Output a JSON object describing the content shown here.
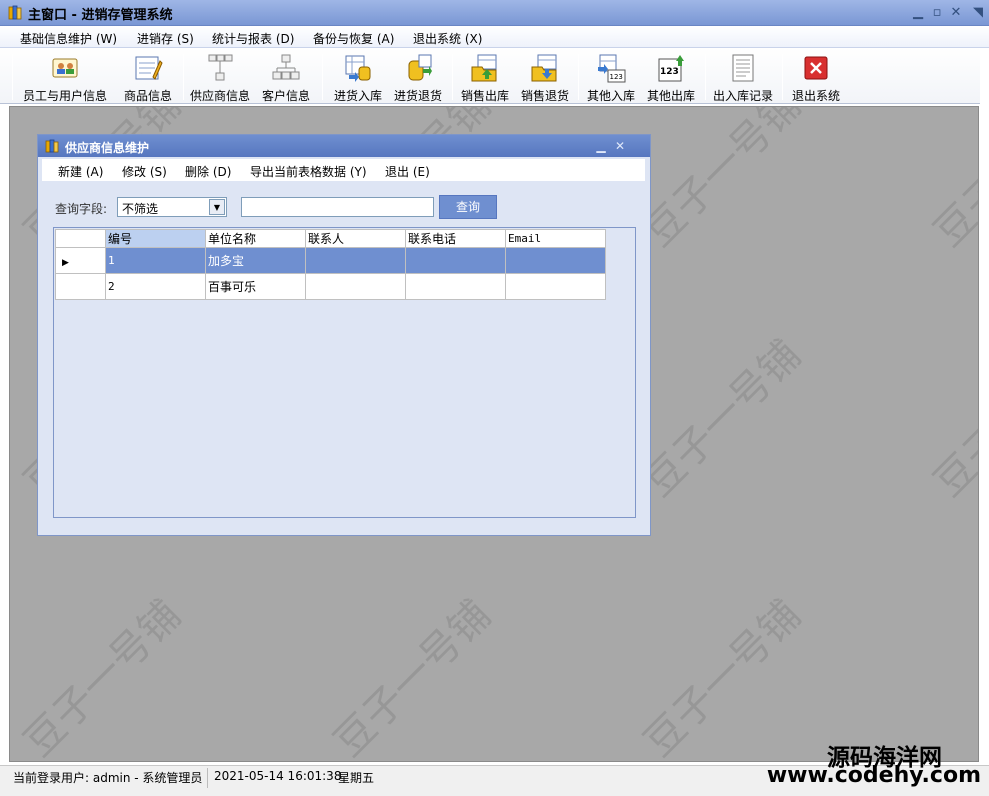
{
  "window": {
    "title": "主窗口 - 进销存管理系统",
    "icon": "books-icon",
    "controls": [
      "minimize",
      "maximize",
      "close"
    ]
  },
  "menubar": [
    "基础信息维护 (W)",
    "进销存 (S)",
    "统计与报表 (D)",
    "备份与恢复 (A)",
    "退出系统 (X)"
  ],
  "toolbar": [
    {
      "label": "员工与用户信息",
      "icon": "staff-icon"
    },
    {
      "label": "商品信息",
      "icon": "product-edit-icon"
    },
    {
      "label": "供应商信息",
      "icon": "supplier-tree-icon"
    },
    {
      "label": "客户信息",
      "icon": "customer-tree-icon"
    },
    {
      "label": "进货入库",
      "icon": "stock-in-icon"
    },
    {
      "label": "进货退货",
      "icon": "stock-return-icon"
    },
    {
      "label": "销售出库",
      "icon": "sale-out-icon"
    },
    {
      "label": "销售退货",
      "icon": "sale-return-icon"
    },
    {
      "label": "其他入库",
      "icon": "other-in-icon"
    },
    {
      "label": "其他出库",
      "icon": "other-out-icon"
    },
    {
      "label": "出入库记录",
      "icon": "record-icon"
    },
    {
      "label": "退出系统",
      "icon": "exit-icon"
    }
  ],
  "child_window": {
    "title": "供应商信息维护",
    "menu": [
      "新建 (A)",
      "修改 (S)",
      "删除 (D)",
      "导出当前表格数据 (Y)",
      "退出 (E)"
    ],
    "query": {
      "label": "查询字段:",
      "field_value": "不筛选",
      "input_value": "",
      "button": "查询"
    },
    "grid": {
      "columns": [
        "编号",
        "单位名称",
        "联系人",
        "联系电话",
        "Email"
      ],
      "rows": [
        {
          "id": "1",
          "name": "加多宝",
          "contact": "",
          "phone": "",
          "email": "",
          "selected": true
        },
        {
          "id": "2",
          "name": "百事可乐",
          "contact": "",
          "phone": "",
          "email": "",
          "selected": false
        }
      ]
    }
  },
  "watermark_text": "豆子一号铺",
  "statusbar": {
    "user": "当前登录用户: admin - 系统管理员",
    "datetime": "2021-05-14 16:01:38",
    "weekday": "星期五"
  },
  "site_watermark": {
    "line1": "源码海洋网",
    "line2": "www.codehy.com"
  },
  "colors": {
    "title_bar": "#7a97d4",
    "child_title_bar": "#5676bf",
    "selected_row": "#6f8fd0",
    "desktop": "#a8a8a8"
  }
}
